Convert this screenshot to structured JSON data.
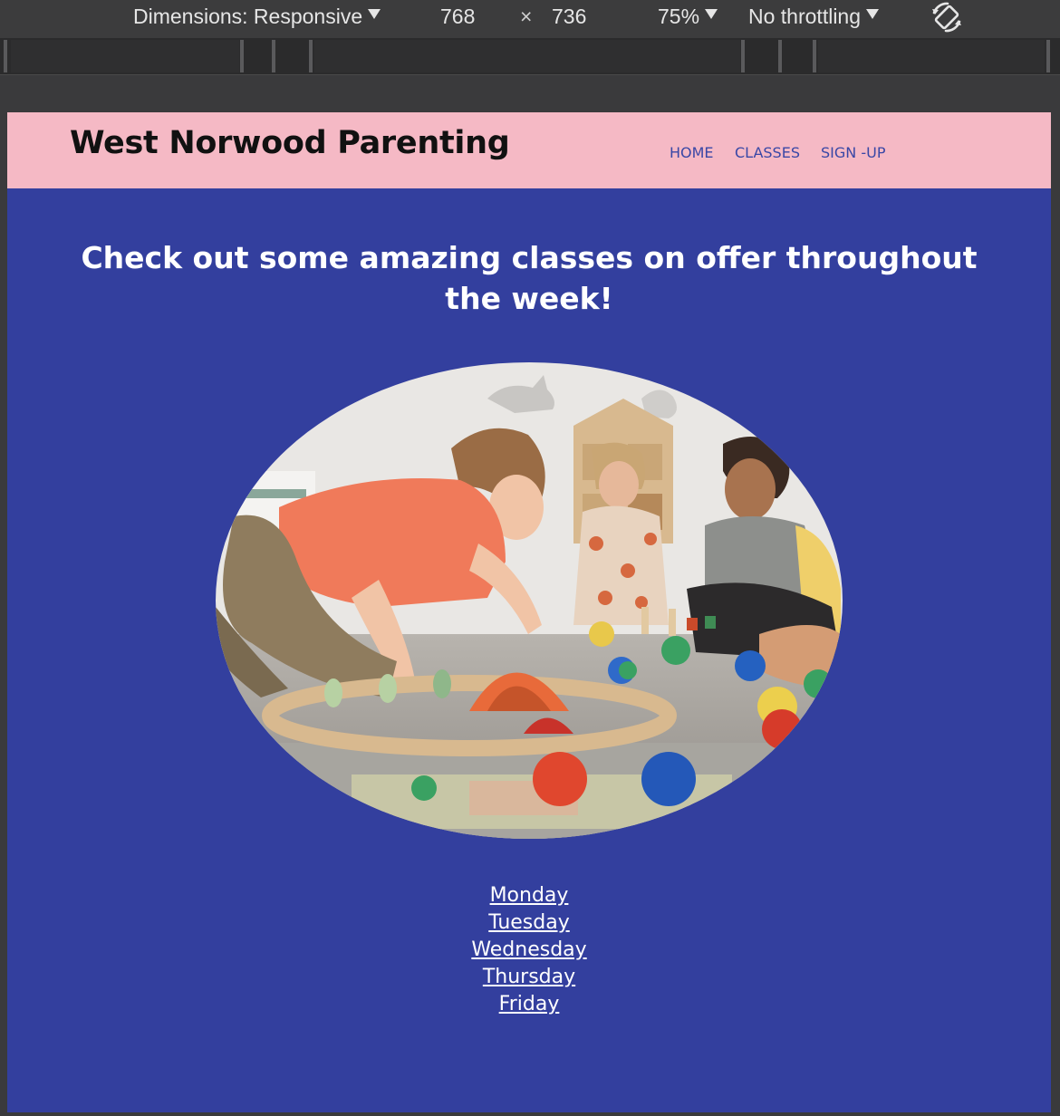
{
  "devtools": {
    "dimensions_label": "Dimensions: Responsive",
    "width": "768",
    "times_symbol": "×",
    "height": "736",
    "zoom": "75%",
    "throttling": "No throttling",
    "rotate_icon": "rotate-device-icon"
  },
  "header": {
    "brand": "West Norwood Parenting",
    "nav": [
      "HOME",
      "CLASSES",
      "SIGN -UP"
    ]
  },
  "main": {
    "headline": "Check out some amazing classes on offer throughout the week!",
    "days": [
      "Monday",
      "Tuesday",
      "Wednesday",
      "Thursday",
      "Friday"
    ]
  },
  "colors": {
    "header_bg": "#f5b9c5",
    "page_bg": "#333f9e",
    "nav_text": "#3947a6",
    "devtools_bg": "#3c3c3d"
  }
}
